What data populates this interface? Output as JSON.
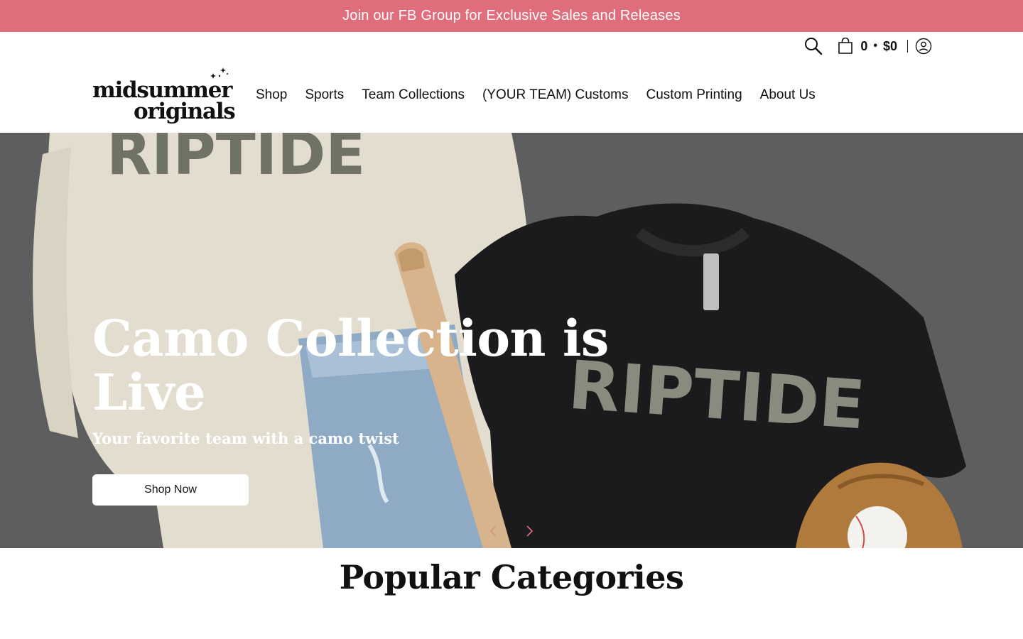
{
  "announcement": {
    "text": "Join our FB Group for Exclusive Sales and Releases",
    "bg_color": "#e06d7b"
  },
  "utility": {
    "search_icon": "search-icon",
    "cart": {
      "icon": "shopping-bag-icon",
      "count": "0",
      "separator": "•",
      "total": "$0"
    },
    "account_icon": "account-icon"
  },
  "logo": {
    "line1": "midsummer",
    "line2": "originals"
  },
  "nav": {
    "items": [
      {
        "label": "Shop"
      },
      {
        "label": "Sports"
      },
      {
        "label": "Team Collections"
      },
      {
        "label": "(YOUR TEAM) Customs"
      },
      {
        "label": "Custom Printing"
      },
      {
        "label": "About Us"
      }
    ]
  },
  "hero": {
    "title": "Camo Collection is Live",
    "subtitle": "Your favorite team with a camo twist",
    "button_label": "Shop Now",
    "shirt_text_left": "RIPTIDE",
    "shirt_text_right": "RIPTIDE",
    "bg_color": "#5e5e5e",
    "prev_icon": "chevron-left-icon",
    "next_icon": "chevron-right-icon"
  },
  "section": {
    "title": "Popular Categories"
  }
}
